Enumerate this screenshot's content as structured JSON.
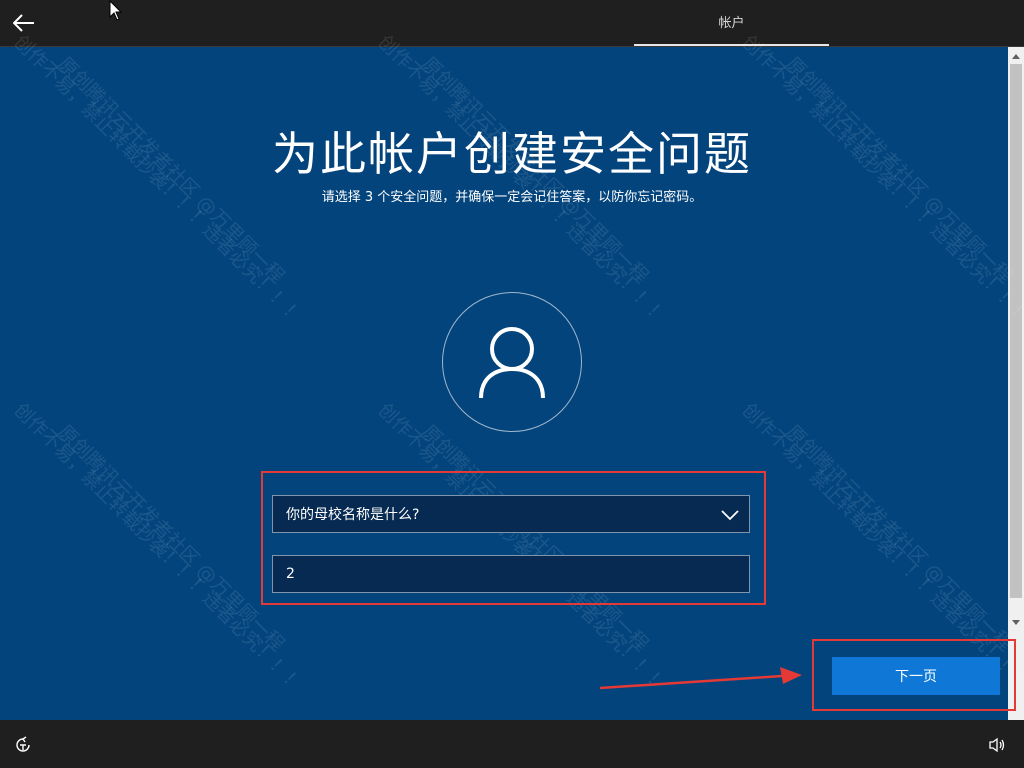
{
  "header": {
    "back_icon": "back-arrow-icon",
    "step_label": "帐户"
  },
  "main": {
    "title": "为此帐户创建安全问题",
    "subtitle": "请选择 3 个安全问题，并确保一定会记住答案，以防你忘记密码。",
    "avatar_icon": "user-icon",
    "question_select": {
      "selected": "你的母校名称是什么?",
      "icon": "chevron-down-icon"
    },
    "answer_input": {
      "value": "2"
    },
    "next_label": "下一页"
  },
  "watermark": {
    "line1": "创作不易，禁止转载抄袭！！！违者必究！！！",
    "line2": "原创腾讯云开发者社区 @万里顾一程"
  },
  "footer": {
    "accessibility_icon": "ease-of-access-icon",
    "volume_icon": "volume-icon"
  },
  "colors": {
    "panel_blue": "#03447d",
    "button_blue": "#0f78d7",
    "highlight_red": "#e53935"
  }
}
